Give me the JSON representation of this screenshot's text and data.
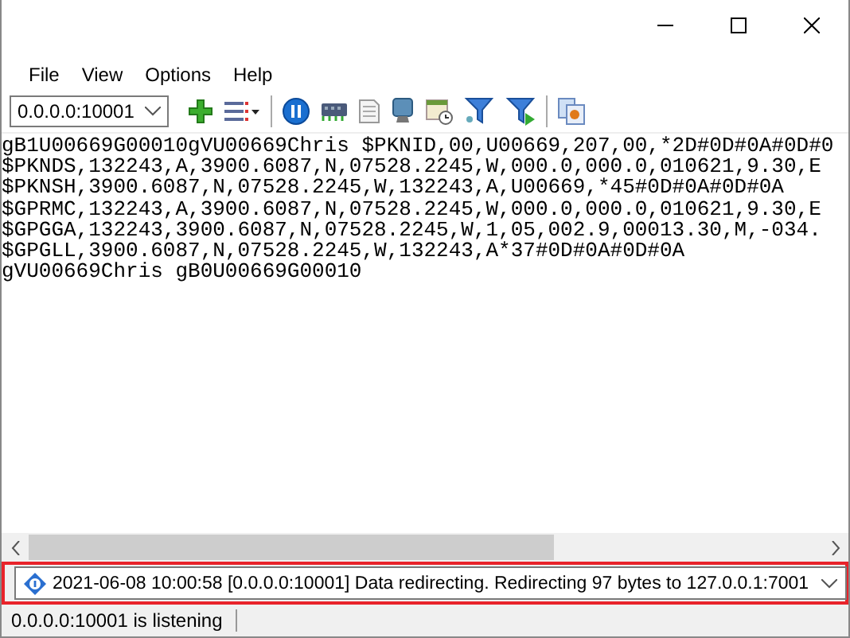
{
  "menu": [
    "File",
    "View",
    "Options",
    "Help"
  ],
  "toolbar": {
    "address": "0.0.0.0:10001"
  },
  "output_lines": [
    "gB1U00669G00010gVU00669Chris $PKNID,00,U00669,207,00,*2D#0D#0A#0D#0",
    "$PKNDS,132243,A,3900.6087,N,07528.2245,W,000.0,000.0,010621,9.30,E",
    "$PKNSH,3900.6087,N,07528.2245,W,132243,A,U00669,*45#0D#0A#0D#0A",
    "$GPRMC,132243,A,3900.6087,N,07528.2245,W,000.0,000.0,010621,9.30,E",
    "$GPGGA,132243,3900.6087,N,07528.2245,W,1,05,002.9,00013.30,M,-034.",
    "$GPGLL,3900.6087,N,07528.2245,W,132243,A*37#0D#0A#0D#0A",
    "gVU00669Chris gB0U00669G00010"
  ],
  "log": {
    "message": "2021-06-08 10:00:58 [0.0.0.0:10001] Data redirecting. Redirecting 97 bytes to 127.0.0.1:7001"
  },
  "status_bar": "0.0.0.0:10001 is listening"
}
